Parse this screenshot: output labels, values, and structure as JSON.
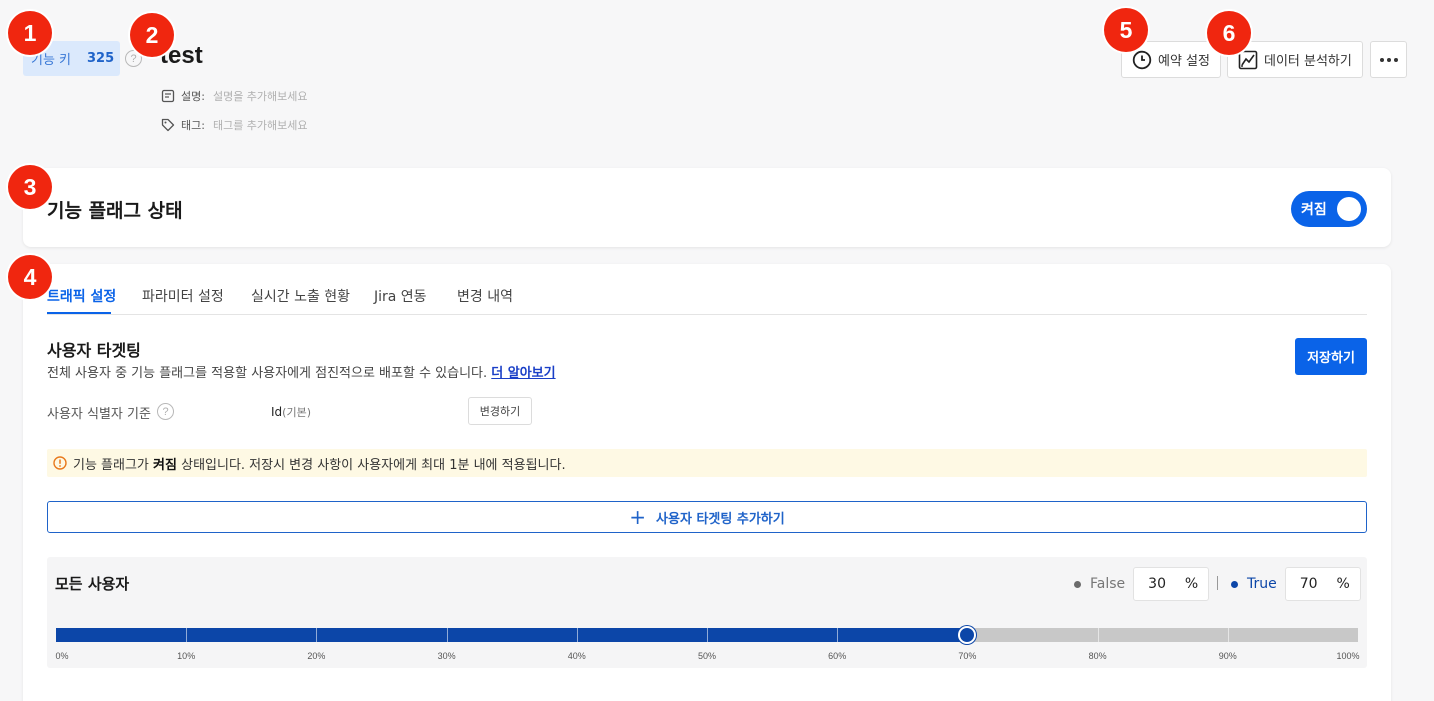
{
  "markers": [
    "1",
    "2",
    "3",
    "4",
    "5",
    "6"
  ],
  "header": {
    "key_label": "기능 키",
    "key_number": "325",
    "help": "?",
    "title": "test",
    "desc_label": "설명:",
    "desc_placeholder": "설명을 추가해보세요",
    "tag_label": "태그:",
    "tag_placeholder": "태그를 추가해보세요",
    "schedule_label": "예약 설정",
    "analyze_label": "데이터 분석하기"
  },
  "status": {
    "title": "기능 플래그 상태",
    "toggle_label": "켜짐"
  },
  "tabs": [
    {
      "label": "트래픽 설정",
      "active": true
    },
    {
      "label": "파라미터 설정"
    },
    {
      "label": "실시간 노출 현황"
    },
    {
      "label": "Jira 연동"
    },
    {
      "label": "변경 내역"
    }
  ],
  "targeting": {
    "title": "사용자 타겟팅",
    "description": "전체 사용자 중 기능 플래그를 적용할 사용자에게 점진적으로 배포할 수 있습니다.",
    "learn_more": "더 알아보기",
    "save_label": "저장하기",
    "identifier_label": "사용자 식별자 기준",
    "identifier_value": "Id",
    "identifier_sub": "(기본)",
    "change_label": "변경하기",
    "notice_pre": "기능 플래그가",
    "notice_bold": "켜짐",
    "notice_post": "상태입니다. 저장시 변경 사항이 사용자에게 최대 1분 내에 적용됩니다.",
    "add_label": "사용자 타겟팅 추가하기"
  },
  "distribution": {
    "title": "모든 사용자",
    "false_label": "False",
    "false_value": "30",
    "true_label": "True",
    "true_value": "70",
    "unit": "%",
    "true_fraction": 0.7,
    "ticks": [
      "0%",
      "10%",
      "20%",
      "30%",
      "40%",
      "50%",
      "60%",
      "70%",
      "80%",
      "90%",
      "100%"
    ]
  },
  "colors": {
    "accent": "#0a63e8",
    "marker": "#f0260f",
    "false_dot": "#6b6b6b",
    "true_dot": "#0c46a8",
    "notice_bg": "#fef9e4"
  }
}
